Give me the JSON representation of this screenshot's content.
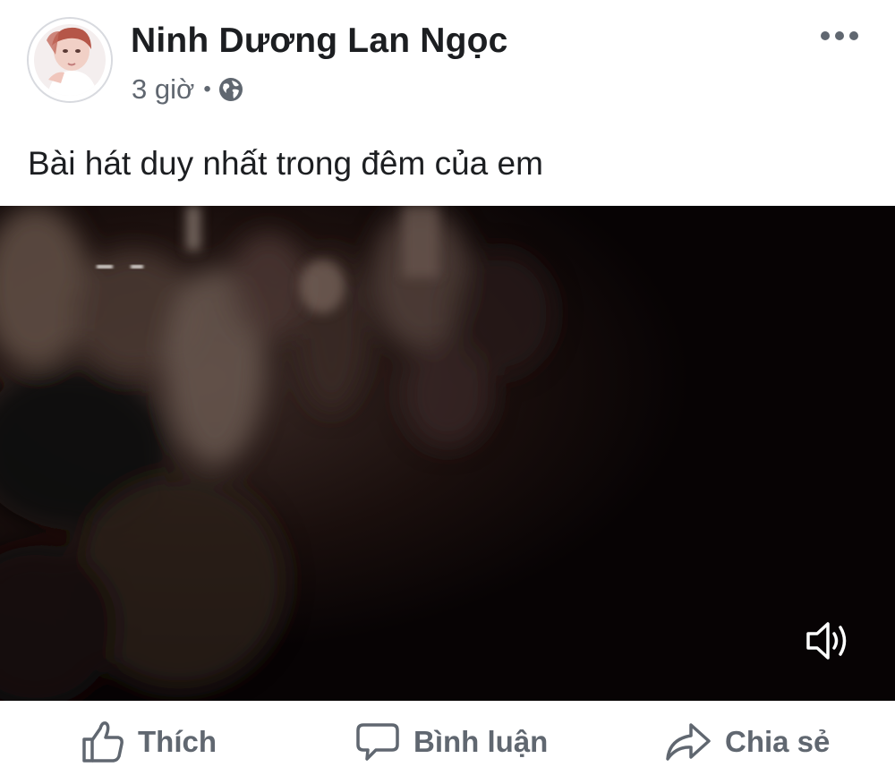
{
  "post": {
    "author": "Ninh Dương Lan Ngọc",
    "time": "3 giờ",
    "separator": "•",
    "privacy_icon": "globe-icon",
    "text": "Bài hát duy nhất trong đêm của em",
    "more_icon": "more-options-icon"
  },
  "video": {
    "volume_icon": "speaker-volume-icon"
  },
  "actions": [
    {
      "label": "Thích",
      "icon": "thumbs-up-icon"
    },
    {
      "label": "Bình luận",
      "icon": "comment-bubble-icon"
    },
    {
      "label": "Chia sẻ",
      "icon": "share-arrow-icon"
    }
  ],
  "colors": {
    "name_text": "#1c1e21",
    "meta_text": "#606770",
    "video_background": "#070304"
  }
}
